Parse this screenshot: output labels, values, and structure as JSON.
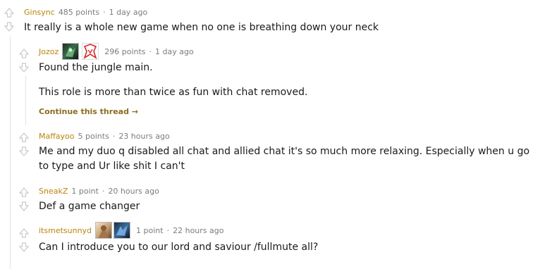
{
  "comments": [
    {
      "author": "Ginsync",
      "points": "485 points",
      "time": "1 day ago",
      "body": [
        "It really is a whole new game when no one is breathing down your neck"
      ]
    },
    {
      "author": "Jozoz",
      "points": "296 points",
      "time": "1 day ago",
      "body": [
        "Found the jungle main.",
        "This role is more than twice as fun with chat removed."
      ],
      "continue_label": "Continue this thread →"
    },
    {
      "author": "Maffayoo",
      "points": "5 points",
      "time": "23 hours ago",
      "body": [
        "Me and my duo q disabled all chat and allied chat it's so much more relaxing. Especially when u go to type and Ur like shit I can't"
      ]
    },
    {
      "author": "SneakZ",
      "points": "1 point",
      "time": "20 hours ago",
      "body": [
        "Def a game changer"
      ]
    },
    {
      "author": "itsmetsunnyd",
      "points": "1 point",
      "time": "22 hours ago",
      "body": [
        "Can I introduce you to our lord and saviour /fullmute all?"
      ]
    }
  ],
  "separator": "·",
  "colors": {
    "author": "#b8860b",
    "meta": "#7c7c7c",
    "arrow": "#c9c9c9"
  }
}
